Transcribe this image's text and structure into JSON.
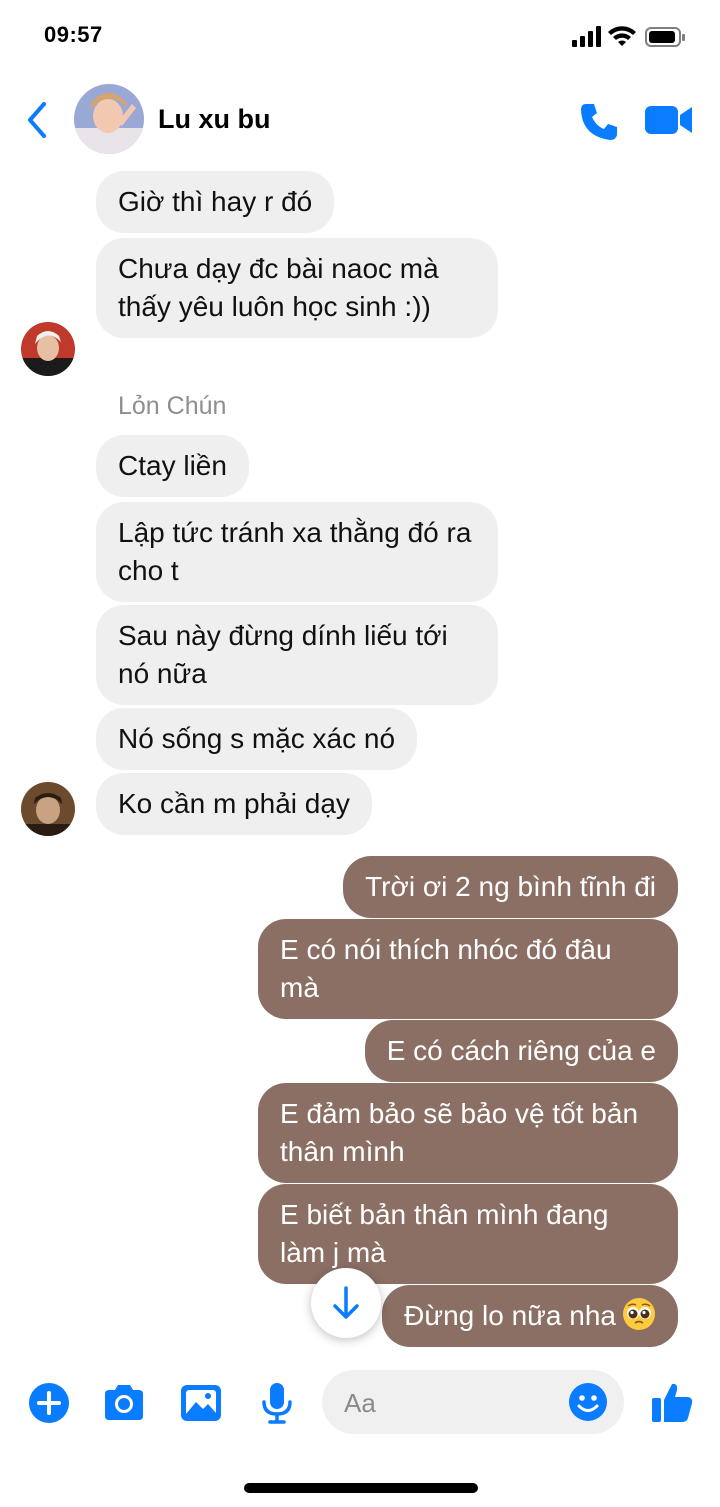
{
  "status_bar": {
    "time": "09:57"
  },
  "header": {
    "contact_name": "Lu xu bu"
  },
  "colors": {
    "accent": "#0a7cff",
    "incoming_bubble": "#efefef",
    "outgoing_bubble": "#8b6f65"
  },
  "messages": {
    "in": [
      "Giờ thì hay r đó",
      "Chưa dạy đc bài naoc mà thấy yêu luôn học sinh :))",
      "Ctay liền",
      "Lập tức tránh xa thằng đó ra cho t",
      "Sau này đừng dính liếu tới nó nữa",
      "Nó sống s mặc xác nó",
      "Ko cần m phải dạy"
    ],
    "sender_name": "Lỏn Chún",
    "out": [
      "Trời ơi 2 ng bình tĩnh đi",
      "E có nói thích nhóc đó đâu mà",
      "E có cách riêng của e",
      "E đảm bảo sẽ bảo vệ tốt bản thân mình",
      "E biết bản thân mình đang làm j mà",
      "Đừng lo nữa nha"
    ]
  },
  "composer": {
    "placeholder": "Aa"
  },
  "icons": [
    "back-chevron-icon",
    "phone-icon",
    "video-camera-icon",
    "arrow-down-icon",
    "plus-icon",
    "camera-icon",
    "image-icon",
    "microphone-icon",
    "smile-icon",
    "thumbs-up-icon",
    "pleading-face-emoji"
  ]
}
